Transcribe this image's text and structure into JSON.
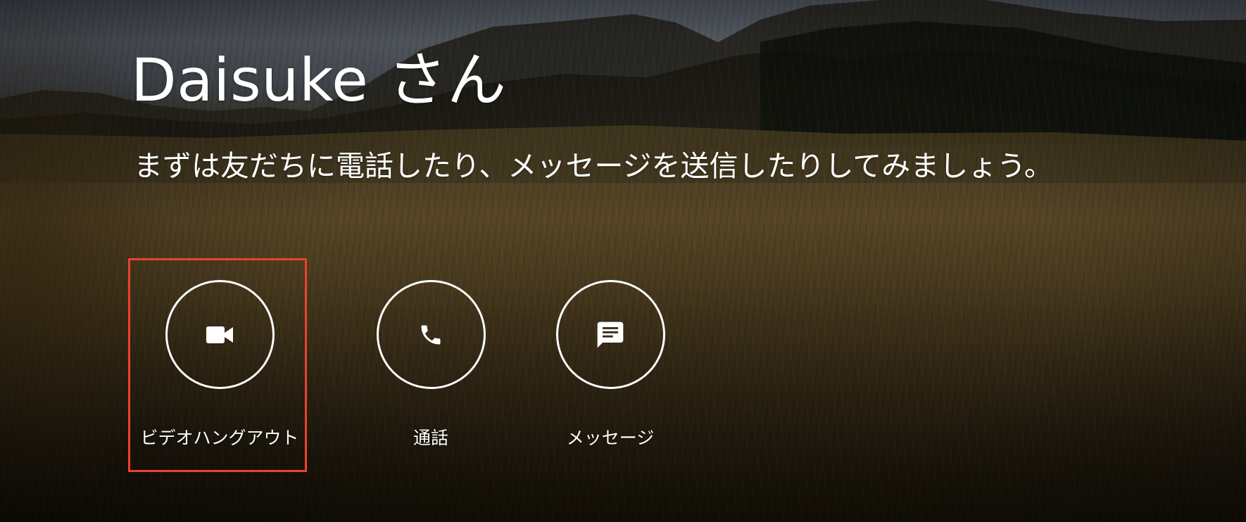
{
  "greeting": "Daisuke さん",
  "subtitle": "まずは友だちに電話したり、メッセージを送信したりしてみましょう。",
  "actions": [
    {
      "label": "ビデオハングアウト",
      "icon": "video-camera-icon"
    },
    {
      "label": "通話",
      "icon": "phone-icon"
    },
    {
      "label": "メッセージ",
      "icon": "chat-message-icon"
    }
  ],
  "highlight": {
    "target": "video-hangout-button",
    "color": "#e8432e"
  }
}
